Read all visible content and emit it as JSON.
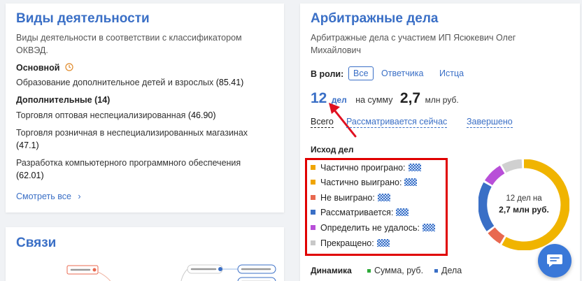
{
  "activities": {
    "title": "Виды деятельности",
    "description": "Виды деятельности в соответствии с классификатором ОКВЭД.",
    "main_label": "Основной",
    "main_item_text": "Образование дополнительное детей и взрослых",
    "main_item_code": "(85.41)",
    "additional_label": "Дополнительные (14)",
    "items": [
      {
        "text": "Торговля оптовая неспециализированная",
        "code": "(46.90)"
      },
      {
        "text": "Торговля розничная в неспециализированных магазинах",
        "code": "(47.1)"
      },
      {
        "text": "Разработка компьютерного программного обеспечения",
        "code": "(62.01)"
      }
    ],
    "see_all": "Смотреть все",
    "see_all_chevron": "›"
  },
  "links": {
    "title": "Связи"
  },
  "arbitration": {
    "title": "Арбитражные дела",
    "description_line1": "Арбитражные дела с участием ИП Ясюкевич Олег",
    "description_line2": "Михайлович",
    "role_label": "В роли:",
    "roles": [
      "Все",
      "Ответчика",
      "Истца"
    ],
    "cases_count": "12",
    "cases_unit": "дел",
    "sum_label": "на сумму",
    "sum_value": "2,7",
    "sum_unit": "млн руб.",
    "status_tabs": [
      "Всего",
      "Рассматривается сейчас",
      "Завершено"
    ],
    "outcome_title": "Исход дел",
    "outcomes": [
      {
        "label": "Частично проиграно:",
        "color": "#f0a500"
      },
      {
        "label": "Частично выиграно:",
        "color": "#f0a500"
      },
      {
        "label": "Не выиграно:",
        "color": "#e8684f"
      },
      {
        "label": "Рассматривается:",
        "color": "#3a6fc6"
      },
      {
        "label": "Определить не удалось:",
        "color": "#b84fd8"
      },
      {
        "label": "Прекращено:",
        "color": "#c8c8c8"
      }
    ],
    "donut_line1": "12 дел на",
    "donut_line2": "2,7 млн руб.",
    "dynamics_label": "Динамика",
    "dynamics_legend": [
      {
        "label": "Сумма, руб.",
        "color": "#2eaa3a"
      },
      {
        "label": "Дела",
        "color": "#3a6fc6"
      }
    ]
  },
  "colors": {
    "accent": "#3a6fc6",
    "highlight_box": "#e00000",
    "arrow": "#e01020"
  },
  "icons": {
    "clock": "clock-icon",
    "chat": "chat-icon"
  }
}
